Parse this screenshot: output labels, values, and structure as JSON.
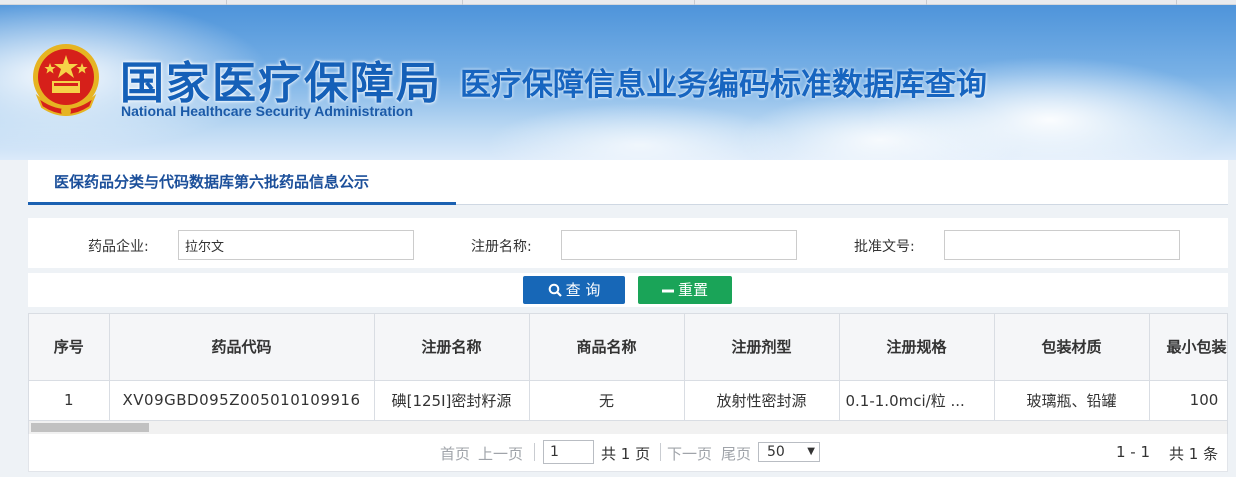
{
  "header": {
    "title_cn": "国家医疗保障局",
    "title_en": "National Healthcare Security Administration",
    "subtitle": "医疗保障信息业务编码标准数据库查询",
    "emblem_icon": "national-emblem-icon"
  },
  "panel": {
    "tab_title": "医保药品分类与代码数据库第六批药品信息公示"
  },
  "filters": {
    "company_label": "药品企业:",
    "company_value": "拉尔文",
    "regname_label": "注册名称:",
    "regname_value": "",
    "approval_label": "批准文号:",
    "approval_value": ""
  },
  "buttons": {
    "query_label": "查 询",
    "query_icon": "search-icon",
    "reset_label": "重置",
    "reset_icon": "minus-icon",
    "query_color": "#1767b7",
    "reset_color": "#1aa458"
  },
  "table": {
    "columns": [
      "序号",
      "药品代码",
      "注册名称",
      "商品名称",
      "注册剂型",
      "注册规格",
      "包装材质",
      "最小包装数"
    ],
    "rows": [
      [
        "1",
        "XV09GBD095Z005010109916",
        "碘[125I]密封籽源",
        "无",
        "放射性密封源",
        "0.1-1.0mci/粒 ...",
        "玻璃瓶、铅罐",
        "100"
      ]
    ]
  },
  "pager": {
    "first": "首页",
    "prev": "上一页",
    "page_value": "1",
    "total_pages": "共 1 页",
    "next": "下一页",
    "last": "尾页",
    "page_size": "50",
    "range": "1 - 1",
    "total": "共 1 条"
  }
}
